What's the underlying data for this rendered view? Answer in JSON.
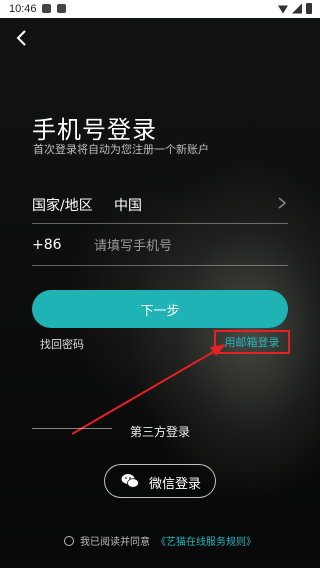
{
  "status_bar": {
    "time": "10:46",
    "icons": [
      "notification-icon",
      "notification-icon",
      "wifi-icon",
      "signal-icon",
      "battery-icon"
    ]
  },
  "nav": {
    "back_icon": "back-chevron-icon"
  },
  "header": {
    "title": "手机号登录",
    "subtitle": "首次登录将自动为您注册一个新账户"
  },
  "form": {
    "region_label": "国家/地区",
    "region_value": "中国",
    "country_code": "+86",
    "phone_value": "",
    "phone_placeholder": "请填写手机号"
  },
  "actions": {
    "next_label": "下一步",
    "find_password_label": "找回密码",
    "email_login_label": "用邮箱登录"
  },
  "third_party": {
    "section_label": "第三方登录",
    "wechat_label": "微信登录"
  },
  "agreement": {
    "prefix": "我已阅读并同意",
    "link": "《艺猫在线服务规则》"
  },
  "colors": {
    "accent": "#1fb3b6",
    "link": "#22b7c0",
    "highlight": "#e52121",
    "background": "#0b0c0c"
  }
}
